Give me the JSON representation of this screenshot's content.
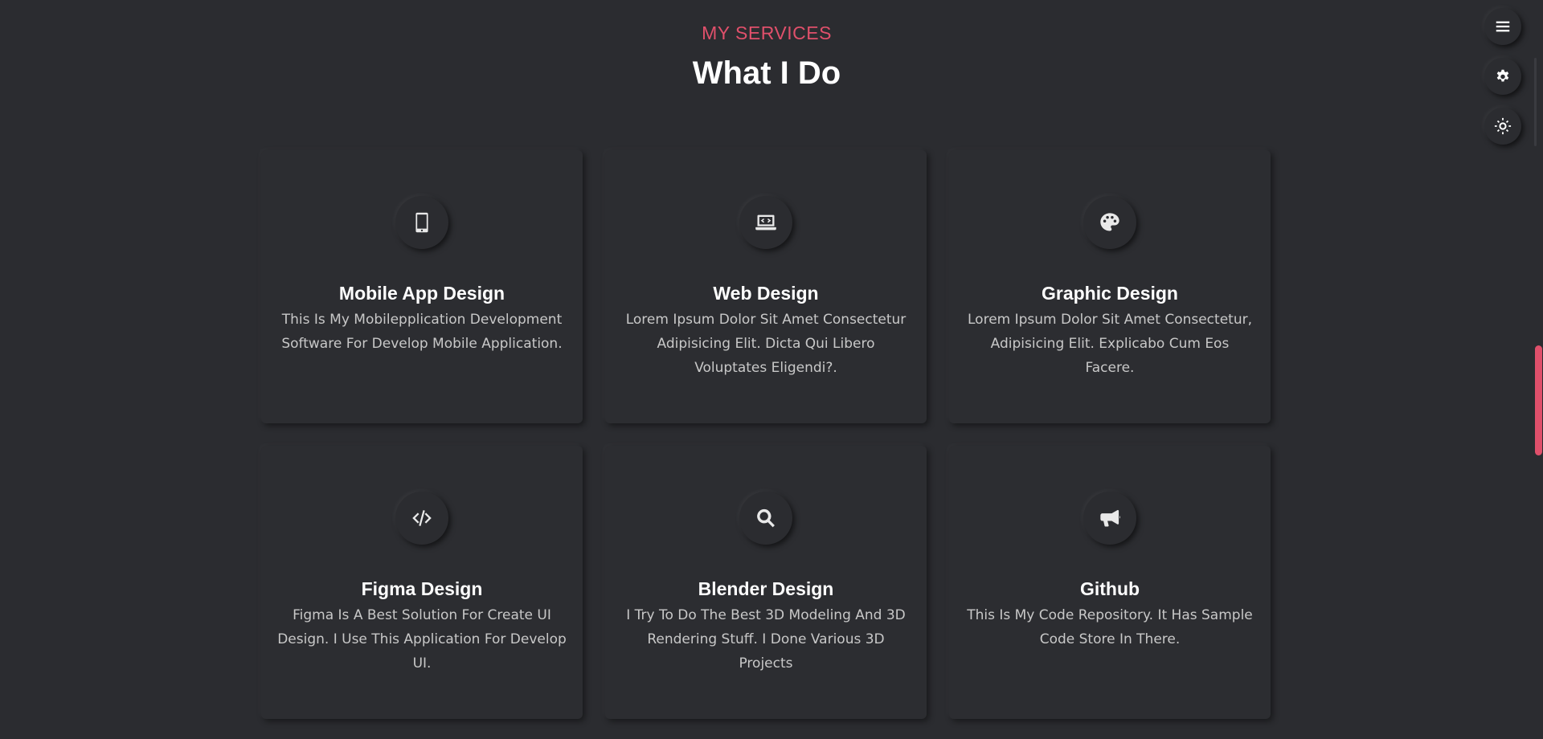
{
  "header": {
    "subtitle": "MY SERVICES",
    "title": "What I Do"
  },
  "services": [
    {
      "icon": "mobile-icon",
      "title": "Mobile App Design",
      "description": "This Is My Mobilepplication Development Software For Develop Mobile Application."
    },
    {
      "icon": "laptop-code-icon",
      "title": "Web Design",
      "description": "Lorem Ipsum Dolor Sit Amet Consectetur Adipisicing Elit. Dicta Qui Libero Voluptates Eligendi?."
    },
    {
      "icon": "palette-icon",
      "title": "Graphic Design",
      "description": "Lorem Ipsum Dolor Sit Amet Consectetur, Adipisicing Elit. Explicabo Cum Eos Facere."
    },
    {
      "icon": "code-icon",
      "title": "Figma Design",
      "description": "Figma Is A Best Solution For Create UI Design. I Use This Application For Develop UI."
    },
    {
      "icon": "search-icon",
      "title": "Blender Design",
      "description": "I Try To Do The Best 3D Modeling And 3D Rendering Stuff. I Done Various 3D Projects"
    },
    {
      "icon": "megaphone-icon",
      "title": "Github",
      "description": "This Is My Code Repository. It Has Sample Code Store In There."
    }
  ],
  "side_controls": [
    {
      "icon": "menu-icon"
    },
    {
      "icon": "gear-icon"
    },
    {
      "icon": "sun-icon"
    }
  ],
  "colors": {
    "background": "#2b2c30",
    "accent": "#e0506b",
    "text": "#ffffff",
    "muted_text": "#c8c8c8"
  }
}
